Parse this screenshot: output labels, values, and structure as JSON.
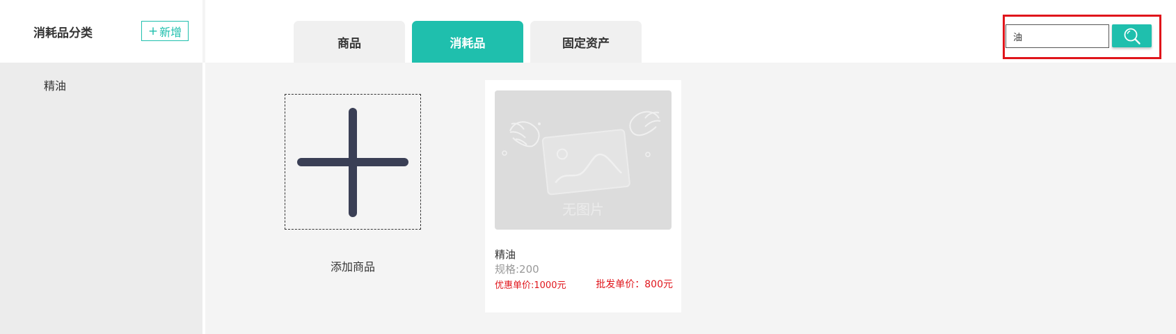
{
  "sidebar": {
    "title": "消耗品分类",
    "add_button": {
      "icon": "plus-icon",
      "label": "新增"
    },
    "items": [
      {
        "label": "精油"
      }
    ]
  },
  "tabs": [
    {
      "label": "商品",
      "active": false
    },
    {
      "label": "消耗品",
      "active": true
    },
    {
      "label": "固定资产",
      "active": false
    }
  ],
  "search": {
    "value": "油",
    "button_icon": "search-icon"
  },
  "add_product": {
    "icon": "plus-icon",
    "label": "添加商品"
  },
  "products": [
    {
      "image_placeholder_text": "无图片",
      "name": "精油",
      "spec": "规格:200",
      "discount_price": "优惠单价:1000元",
      "wholesale_price": "批发单价：800元"
    }
  ],
  "colors": {
    "accent": "#1fbfad",
    "highlight": "#e0151b",
    "price": "#e0151b",
    "sidebar_bg": "#ececec",
    "content_bg": "#f4f4f4"
  }
}
